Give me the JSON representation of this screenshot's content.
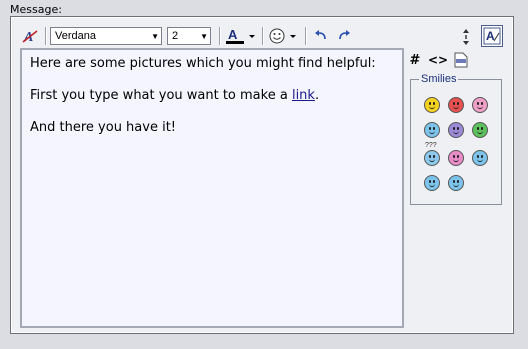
{
  "label": "Message:",
  "toolbar": {
    "font_name": "Verdana",
    "font_size": "2",
    "hash_symbol": "#",
    "code_symbol": "<>"
  },
  "editor": {
    "line1": "Here are some pictures which you might find helpful:",
    "line2_before": "First you type what you want to make a ",
    "line2_link": "link",
    "line2_after": ".",
    "line3": "And there you have it!"
  },
  "smilies": {
    "title": "Smilies",
    "question_marks": "???",
    "items": [
      {
        "name": "smile",
        "color": "#f5d21e"
      },
      {
        "name": "mad",
        "color": "#e85050"
      },
      {
        "name": "tongue",
        "color": "#f0a0c8"
      },
      {
        "name": "cool-blue",
        "color": "#7cc4ec"
      },
      {
        "name": "frown",
        "color": "#9c8ad8"
      },
      {
        "name": "grin",
        "color": "#5cc05c"
      },
      {
        "name": "confused",
        "color": "#8cc8ec"
      },
      {
        "name": "embarrassed",
        "color": "#e88cc8"
      },
      {
        "name": "rolleyes",
        "color": "#7cc4ec"
      },
      {
        "name": "cool",
        "color": "#7cc4ec"
      },
      {
        "name": "eek",
        "color": "#7cc4ec"
      }
    ]
  },
  "colors": {
    "accent": "#1c2f7a",
    "background": "#dcdde3",
    "panel": "#eef0f4",
    "editor": "#f4f5ff"
  }
}
